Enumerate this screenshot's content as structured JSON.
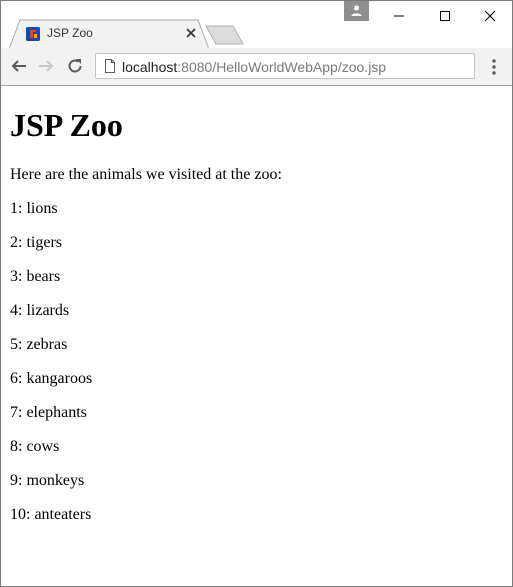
{
  "browser": {
    "tab": {
      "title": "JSP Zoo",
      "favicon": "java-favicon-icon"
    },
    "address_bar": {
      "host": "localhost",
      "rest": ":8080/HelloWorldWebApp/zoo.jsp"
    },
    "icons": {
      "back": "back-arrow-icon",
      "forward": "forward-arrow-icon",
      "reload": "reload-icon",
      "menu": "three-dots-menu-icon",
      "profile": "profile-icon"
    }
  },
  "page": {
    "heading": "JSP Zoo",
    "intro": "Here are the animals we visited at the zoo:",
    "animals": [
      "1: lions",
      "2: tigers",
      "3: bears",
      "4: lizards",
      "5: zebras",
      "6: kangaroos",
      "7: elephants",
      "8: cows",
      "9: monkeys",
      "10: anteaters"
    ]
  },
  "colors": {
    "toolbar_bg": "#f2f2f2",
    "tab_bg": "#f2f2f2",
    "profile_bg": "#8f8f8f",
    "url_gray": "#7a7a7a"
  }
}
